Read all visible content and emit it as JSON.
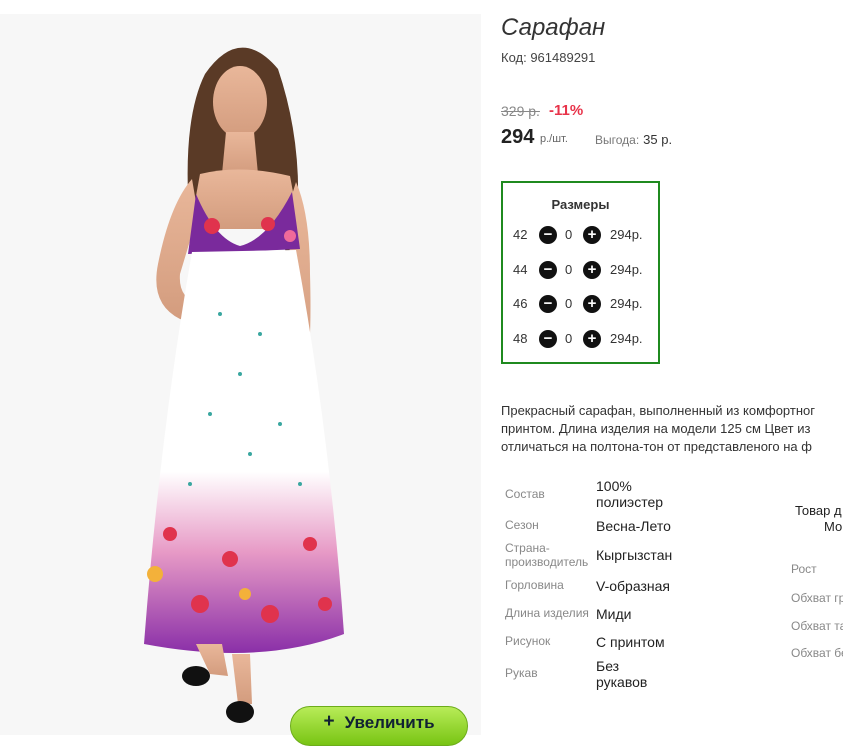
{
  "product": {
    "title": "Сарафан",
    "code": "Код: 961489291",
    "old_price": "329 р.",
    "discount": "-11%",
    "price": "294",
    "price_unit": "р./шт.",
    "benefit_label": "Выгода:",
    "benefit_value": "35 р."
  },
  "zoom": {
    "plus": "+",
    "label": "Увеличить"
  },
  "sizes": {
    "title": "Размеры",
    "minus_symbol": "−",
    "plus_symbol": "+",
    "rows": [
      {
        "size": "42",
        "qty": "0",
        "price": "294р."
      },
      {
        "size": "44",
        "qty": "0",
        "price": "294р."
      },
      {
        "size": "46",
        "qty": "0",
        "price": "294р."
      },
      {
        "size": "48",
        "qty": "0",
        "price": "294р."
      }
    ]
  },
  "description": {
    "lines": [
      "Прекрасный сарафан, выполненный из комфортног",
      "принтом. Длина изделия на модели 125 см Цвет из",
      "отличаться на полтона-тон от представленого на ф"
    ]
  },
  "specs": [
    {
      "label": "Состав",
      "value": "100% полиэстер"
    },
    {
      "label": "Сезон",
      "value": "Весна-Лето"
    },
    {
      "label": "Страна-производитель",
      "value": "Кыргызстан"
    },
    {
      "label": "Горловина",
      "value": "V-образная"
    },
    {
      "label": "Длина изделия",
      "value": "Миди"
    },
    {
      "label": "Рисунок",
      "value": "С принтом"
    },
    {
      "label": "Рукав",
      "value": "Без рукавов"
    }
  ],
  "right_column": {
    "line1": "Товар д",
    "line2": "Мо",
    "labels": [
      "Рост",
      "Обхват гр",
      "Обхват та",
      "Обхват бе"
    ]
  },
  "colors": {
    "accent_green_border": "#1f8a1f",
    "discount_red": "#e8334a",
    "zoom_button_green": "#8fd42a"
  }
}
